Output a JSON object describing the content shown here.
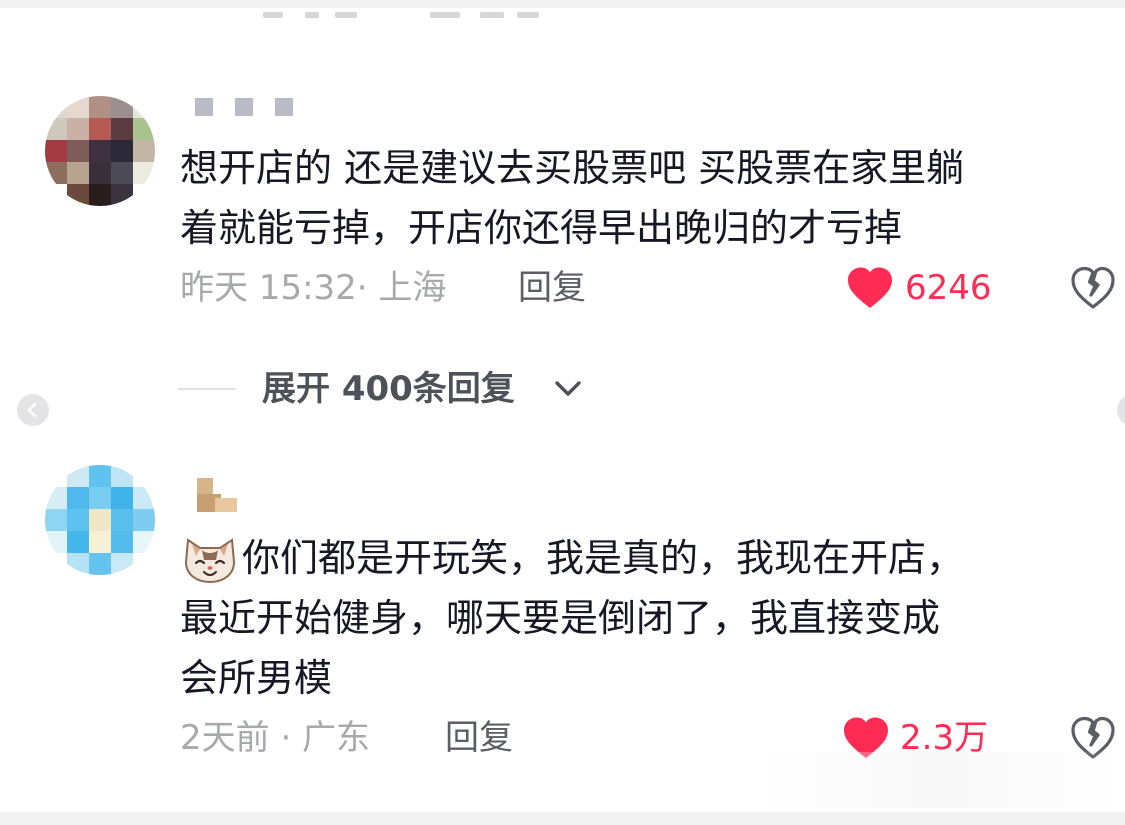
{
  "comments": [
    {
      "text": "想开店的 还是建议去买股票吧 买股票在家里躺\n着就能亏掉，开店你还得早出晚归的才亏掉",
      "meta": "昨天 15:32· 上海",
      "reply_label": "回复",
      "likes": "6246",
      "liked": true
    },
    {
      "text": "你们都是开玩笑，我是真的，我现在开店，\n最近开始健身，哪天要是倒闭了，我直接变成\n会所男模",
      "emoji": "cat-emoji",
      "meta": "2天前 · 广东",
      "reply_label": "回复",
      "likes": "2.3万",
      "liked": true
    }
  ],
  "expand_replies": {
    "label": "展开 400条回复"
  },
  "colors": {
    "like_red": "#fe2c55",
    "meta_gray": "#a8a9ad",
    "text_dark": "#161823"
  },
  "icons": [
    "heart-icon",
    "dislike-broken-heart-icon",
    "chevron-down-icon",
    "chevron-left-icon",
    "chevron-right-icon"
  ]
}
